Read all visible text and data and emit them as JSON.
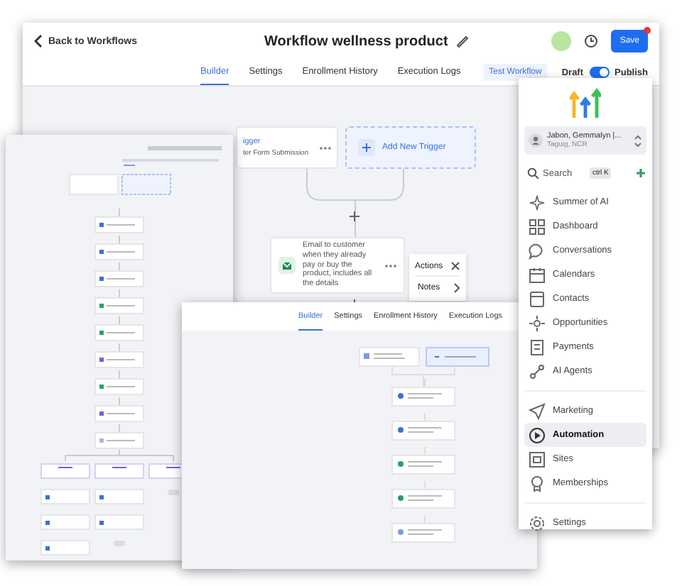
{
  "main_window": {
    "back_link": "Back to Workflows",
    "title": "Workflow wellness product",
    "save_button": "Save",
    "tabs": [
      {
        "label": "Builder",
        "selected": true
      },
      {
        "label": "Settings",
        "selected": false
      },
      {
        "label": "Enrollment History",
        "selected": false
      },
      {
        "label": "Execution Logs",
        "selected": false
      }
    ],
    "test_button": "Test Workflow",
    "publish_toggle": {
      "off_label": "Draft",
      "on_label": "Publish",
      "on": true
    },
    "nodes": [
      {
        "kind": "trigger",
        "title": "igger",
        "subtitle": "ter Form Submission"
      },
      {
        "kind": "add",
        "label": "Add New Trigger"
      },
      {
        "kind": "action",
        "text": "Email to customer when they already pay or buy the product, includes all the details"
      }
    ],
    "actions_menu": {
      "title": "Actions",
      "items": [
        "Notes"
      ]
    }
  },
  "preview_window": {
    "tabs": [
      {
        "label": "Builder",
        "selected": true
      },
      {
        "label": "Settings",
        "selected": false
      },
      {
        "label": "Enrollment History",
        "selected": false
      },
      {
        "label": "Execution Logs",
        "selected": false
      }
    ]
  },
  "sidebar": {
    "account": {
      "name": "Jabon, Gemmalyn |...",
      "location": "Taguig, NCR"
    },
    "search": {
      "placeholder": "Search",
      "shortcut": "ctrl K"
    },
    "groups": [
      [
        {
          "label": "Summer of AI",
          "selected": false
        },
        {
          "label": "Dashboard",
          "selected": false
        },
        {
          "label": "Conversations",
          "selected": false
        },
        {
          "label": "Calendars",
          "selected": false
        },
        {
          "label": "Contacts",
          "selected": false
        },
        {
          "label": "Opportunities",
          "selected": false
        },
        {
          "label": "Payments",
          "selected": false
        },
        {
          "label": "AI Agents",
          "selected": false
        }
      ],
      [
        {
          "label": "Marketing",
          "selected": false
        },
        {
          "label": "Automation",
          "selected": true
        },
        {
          "label": "Sites",
          "selected": false
        },
        {
          "label": "Memberships",
          "selected": false
        }
      ],
      [
        {
          "label": "Settings",
          "selected": false
        }
      ]
    ]
  }
}
